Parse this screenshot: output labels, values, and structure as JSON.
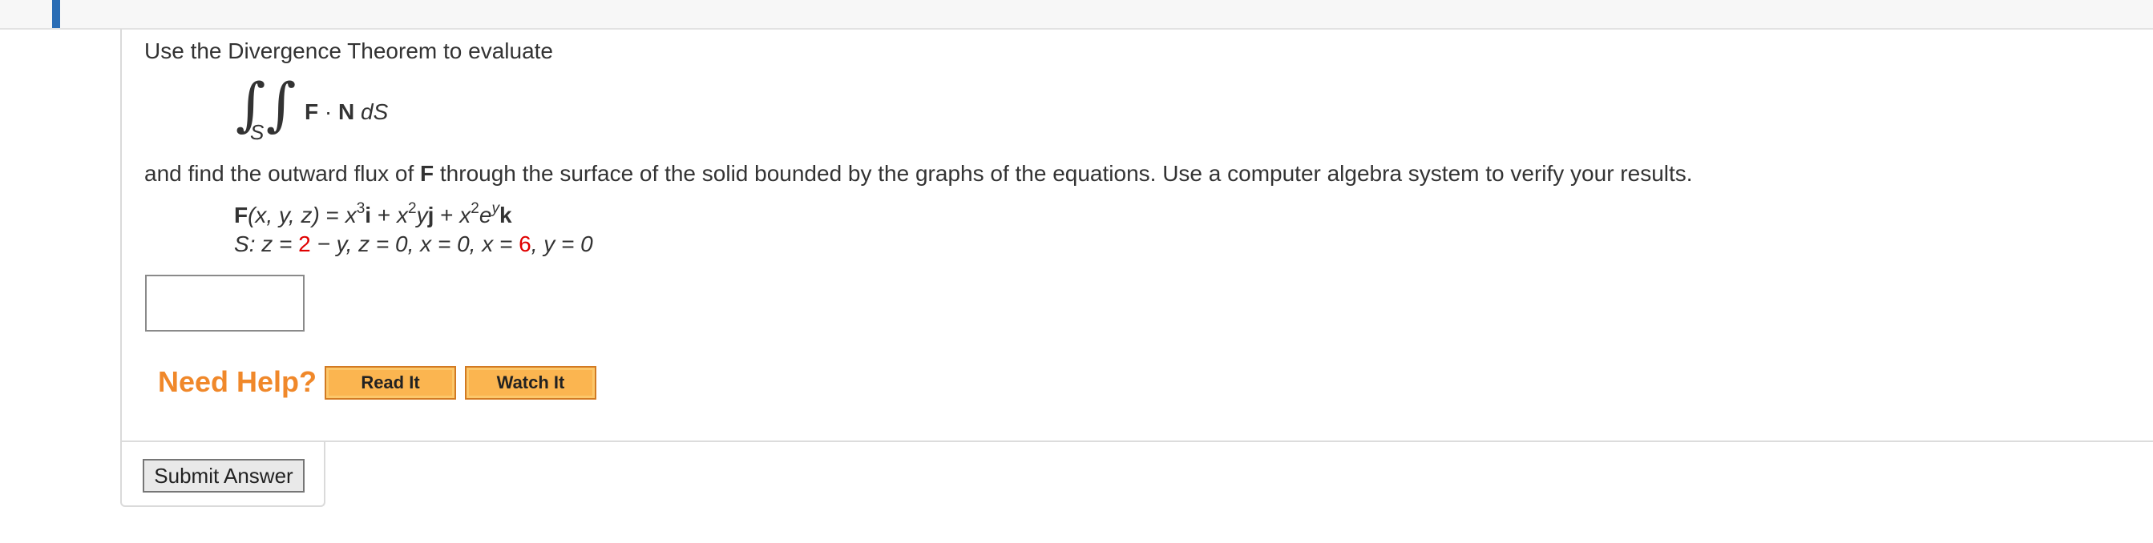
{
  "question": {
    "intro": "Use the Divergence Theorem to evaluate",
    "integral": {
      "sign": "∫",
      "subscript": "S",
      "field": "F",
      "dot": " · ",
      "normal": "N",
      "measure": "dS"
    },
    "flux_before": "and find the outward flux of ",
    "flux_bold": "F",
    "flux_after": " through the surface of the solid bounded by the graphs of the equations. Use a computer algebra system to verify your results.",
    "field_eq": {
      "lhs_F": "F",
      "lhs_args": "(x, y, z)",
      "eq": " = ",
      "t1_base": "x",
      "t1_exp": "3",
      "t1_unit": "i",
      "plus1": " + ",
      "t2_base": "x",
      "t2_exp": "2",
      "t2_var": "y",
      "t2_unit": "j",
      "plus2": " + ",
      "t3_base": "x",
      "t3_exp": "2",
      "t3_e": "e",
      "t3_eexp": "y",
      "t3_unit": "k"
    },
    "surface_eq": {
      "label": "S",
      "part1": ": z = ",
      "val1": "2",
      "part2": " − y, z = 0, x = 0, x = ",
      "val2": "6",
      "part3": ", y = 0"
    }
  },
  "answer": {
    "value": ""
  },
  "help": {
    "label": "Need Help?",
    "read_it": "Read It",
    "watch_it": "Watch It"
  },
  "submit_label": "Submit Answer",
  "colors": {
    "accent": "#2a6db5",
    "help_orange": "#f0882a",
    "button_fill": "#fbb550",
    "highlight_red": "#e00000"
  }
}
